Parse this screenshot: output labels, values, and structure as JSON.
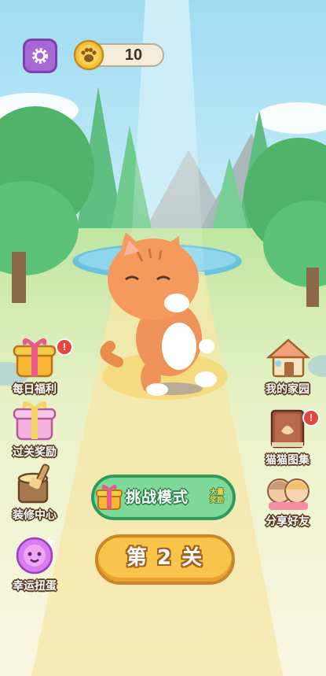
{
  "hud": {
    "settings_icon": "gear-icon",
    "coin_icon": "paw-coin-icon",
    "coin_value": "10"
  },
  "left_menu": [
    {
      "label": "每日福利",
      "icon": "gift-box-icon",
      "badge": "!"
    },
    {
      "label": "过关奖励",
      "icon": "gift-box-icon",
      "badge": ""
    },
    {
      "label": "装修中心",
      "icon": "paint-bucket-icon",
      "badge": ""
    },
    {
      "label": "幸运扭蛋",
      "icon": "gacha-ball-icon",
      "badge": ""
    }
  ],
  "right_menu": [
    {
      "label": "我的家园",
      "icon": "house-icon",
      "badge": ""
    },
    {
      "label": "猫猫图集",
      "icon": "book-icon",
      "badge": "!"
    },
    {
      "label": "分享好友",
      "icon": "friends-icon",
      "badge": ""
    }
  ],
  "challenge": {
    "label": "挑战模式",
    "tag_line1": "大量",
    "tag_line2": "奖励",
    "icon": "gift-icon"
  },
  "level": {
    "label": "第 2 关"
  },
  "colors": {
    "settings": "#a768d6",
    "challenge": "#7ed99a",
    "level": "#f9c44a"
  }
}
